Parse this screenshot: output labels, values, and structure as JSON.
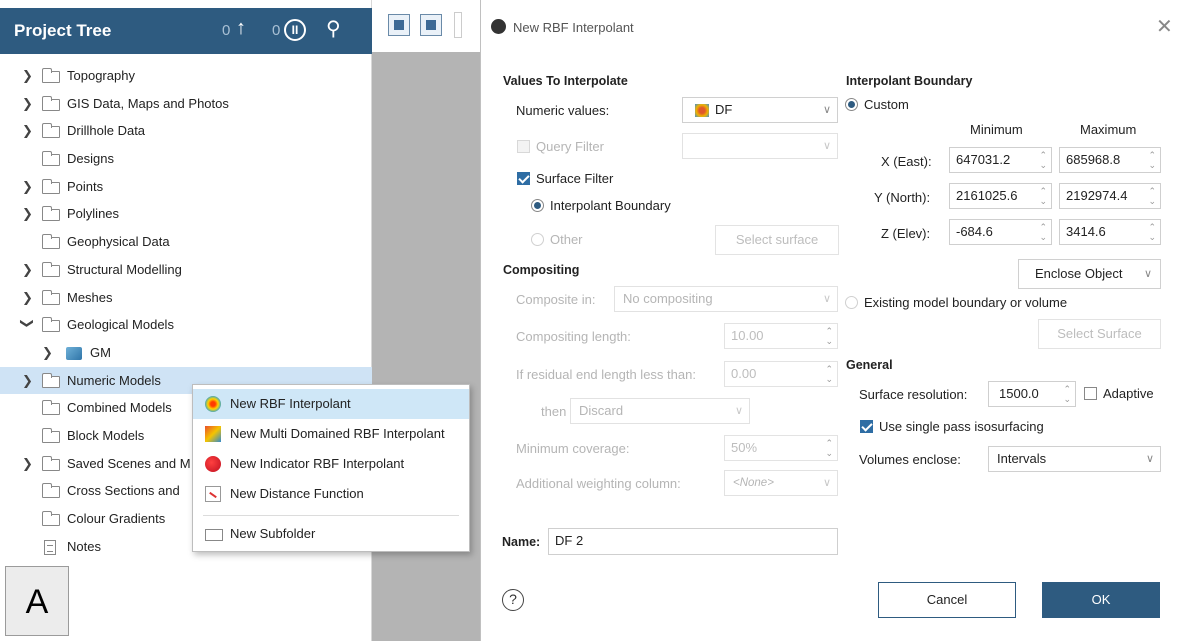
{
  "project_tree": {
    "title": "Project Tree",
    "header_count_1": "0",
    "header_count_2": "0",
    "items": [
      {
        "label": "Topography"
      },
      {
        "label": "GIS Data, Maps and Photos"
      },
      {
        "label": "Drillhole Data"
      },
      {
        "label": "Designs"
      },
      {
        "label": "Points"
      },
      {
        "label": "Polylines"
      },
      {
        "label": "Geophysical Data"
      },
      {
        "label": "Structural Modelling"
      },
      {
        "label": "Meshes"
      },
      {
        "label": "Geological Models"
      },
      {
        "label": "GM"
      },
      {
        "label": "Numeric Models"
      },
      {
        "label": "Combined Models"
      },
      {
        "label": "Block Models"
      },
      {
        "label": "Saved Scenes and M"
      },
      {
        "label": "Cross Sections and"
      },
      {
        "label": "Colour Gradients"
      },
      {
        "label": "Notes"
      }
    ]
  },
  "panel_label": "A",
  "context_menu": {
    "items": [
      {
        "label": "New RBF Interpolant"
      },
      {
        "label": "New Multi Domained RBF Interpolant"
      },
      {
        "label": "New Indicator RBF Interpolant"
      },
      {
        "label": "New Distance Function"
      },
      {
        "label": "New Subfolder"
      }
    ]
  },
  "dialog": {
    "title": "New RBF Interpolant",
    "values_section": "Values To Interpolate",
    "numeric_values_label": "Numeric values:",
    "numeric_values_value": "DF",
    "query_filter_label": "Query Filter",
    "surface_filter_label": "Surface Filter",
    "interpolant_boundary_radio": "Interpolant Boundary",
    "other_radio": "Other",
    "select_surface_btn": "Select surface",
    "compositing_section": "Compositing",
    "composite_in_label": "Composite in:",
    "composite_in_value": "No compositing",
    "compositing_length_label": "Compositing length:",
    "compositing_length_value": "10.00",
    "residual_label": "If residual end length less than:",
    "residual_value": "0.00",
    "then_label": "then",
    "then_value": "Discard",
    "min_coverage_label": "Minimum coverage:",
    "min_coverage_value": "50%",
    "add_weighting_label": "Additional weighting column:",
    "add_weighting_value": "<None>",
    "name_label": "Name:",
    "name_value": "DF 2",
    "boundary_section": "Interpolant Boundary",
    "custom_radio": "Custom",
    "minimum_header": "Minimum",
    "maximum_header": "Maximum",
    "x_label": "X (East):",
    "x_min": "647031.2",
    "x_max": "685968.8",
    "y_label": "Y (North):",
    "y_min": "2161025.6",
    "y_max": "2192974.4",
    "z_label": "Z (Elev):",
    "z_min": "-684.6",
    "z_max": "3414.6",
    "enclose_object_btn": "Enclose Object",
    "existing_radio": "Existing model boundary or volume",
    "select_surface2_btn": "Select Surface",
    "general_section": "General",
    "surface_resolution_label": "Surface resolution:",
    "surface_resolution_value": "1500.0",
    "adaptive_label": "Adaptive",
    "single_pass_label": "Use single pass isosurfacing",
    "volumes_enclose_label": "Volumes enclose:",
    "volumes_enclose_value": "Intervals",
    "cancel_label": "Cancel",
    "ok_label": "OK",
    "help_symbol": "?"
  }
}
